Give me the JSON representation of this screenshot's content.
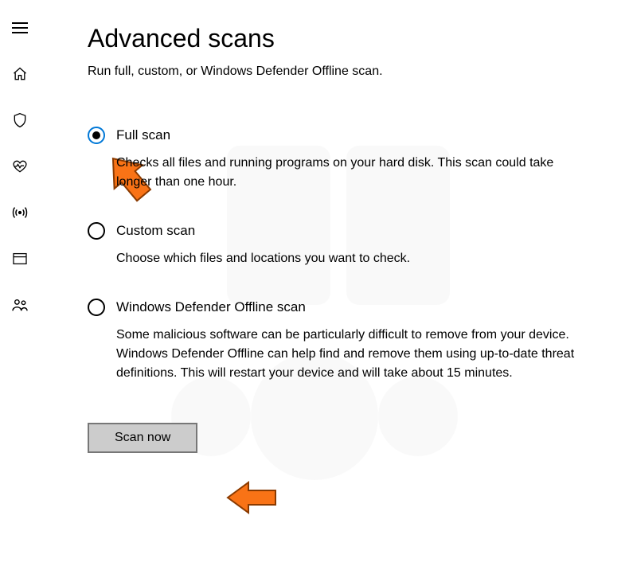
{
  "header": {
    "title": "Advanced scans",
    "subtitle": "Run full, custom, or Windows Defender Offline scan."
  },
  "sidebar": {
    "icons": [
      "menu",
      "home",
      "shield",
      "heart",
      "signal",
      "window",
      "people"
    ]
  },
  "options": [
    {
      "label": "Full scan",
      "description": "Checks all files and running programs on your hard disk. This scan could take longer than one hour.",
      "selected": true
    },
    {
      "label": "Custom scan",
      "description": "Choose which files and locations you want to check.",
      "selected": false
    },
    {
      "label": "Windows Defender Offline scan",
      "description": "Some malicious software can be particularly difficult to remove from your device. Windows Defender Offline can help find and remove them using up-to-date threat definitions. This will restart your device and will take about 15 minutes.",
      "selected": false
    }
  ],
  "action": {
    "scan_button": "Scan now"
  },
  "colors": {
    "accent": "#0078d7",
    "annotation": "#f97316"
  }
}
